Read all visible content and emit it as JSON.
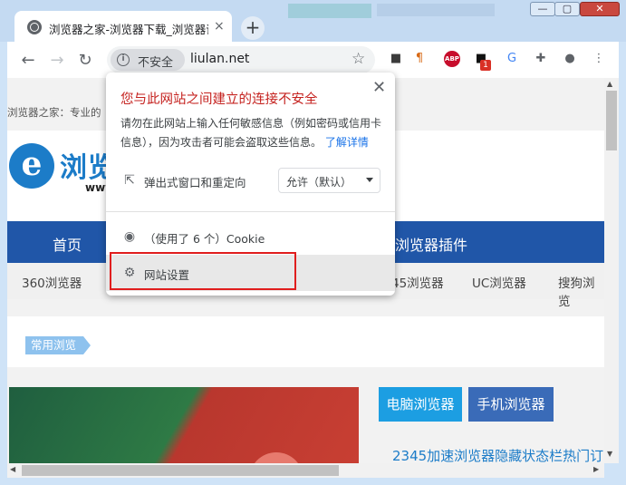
{
  "window": {
    "tab_title": "浏览器之家-浏览器下载_浏览器评",
    "tab_close": "×",
    "new_tab": "+",
    "controls": {
      "minimize": "—",
      "maximize": "▢",
      "close": "✕"
    }
  },
  "toolbar": {
    "back": "←",
    "forward": "→",
    "reload": "↻",
    "security_label": "不安全",
    "security_icon": "i",
    "url": "liulan.net",
    "bookmark": "☆",
    "extensions": [
      {
        "name": "tampermonkey-icon",
        "glyph": "■",
        "color": "#3b3b3b"
      },
      {
        "name": "paragraph-icon",
        "glyph": "¶",
        "color": "#d86a17"
      },
      {
        "name": "abp-icon",
        "glyph": "ABP",
        "color": "#c70d2c"
      },
      {
        "name": "badge-ext-icon",
        "glyph": "■",
        "color": "#111111",
        "badge": "1"
      },
      {
        "name": "translate-icon",
        "glyph": "G",
        "color": "#4285f4"
      },
      {
        "name": "puzzle-icon",
        "glyph": "✚",
        "color": "#5f6368"
      },
      {
        "name": "profile-icon",
        "glyph": "●",
        "color": "#5f6368"
      },
      {
        "name": "menu-icon",
        "glyph": "⋮",
        "color": "#5f6368"
      }
    ]
  },
  "page": {
    "breadcrumb": "浏览器之家：专业的",
    "logo_mark": "e",
    "logo_text": "浏览",
    "logo_sub": "www",
    "nav": [
      "首页",
      "浏览器插件"
    ],
    "subnav": [
      "360浏览器",
      "45浏览器",
      "UC浏览器",
      "搜狗浏览"
    ],
    "tag": "常用浏览",
    "side_tabs": [
      "电脑浏览器",
      "手机浏览器"
    ],
    "side_link": "2345加速浏览器隐藏状态栏热门订"
  },
  "popup": {
    "title": "您与此网站之间建立的连接不安全",
    "description": "请勿在此网站上输入任何敏感信息（例如密码或信用卡信息），因为攻击者可能会盗取这些信息。",
    "learn_more": "了解详情",
    "popups_label": "弹出式窗口和重定向",
    "popups_value": "允许（默认）",
    "cookie_label": "（使用了 6 个）Cookie",
    "settings_label": "网站设置",
    "close": "✕"
  },
  "colors": {
    "accent_red": "#c5221f",
    "link_blue": "#1a73e8",
    "nav_blue": "#2056a8",
    "highlight_red": "#e01e1e"
  }
}
